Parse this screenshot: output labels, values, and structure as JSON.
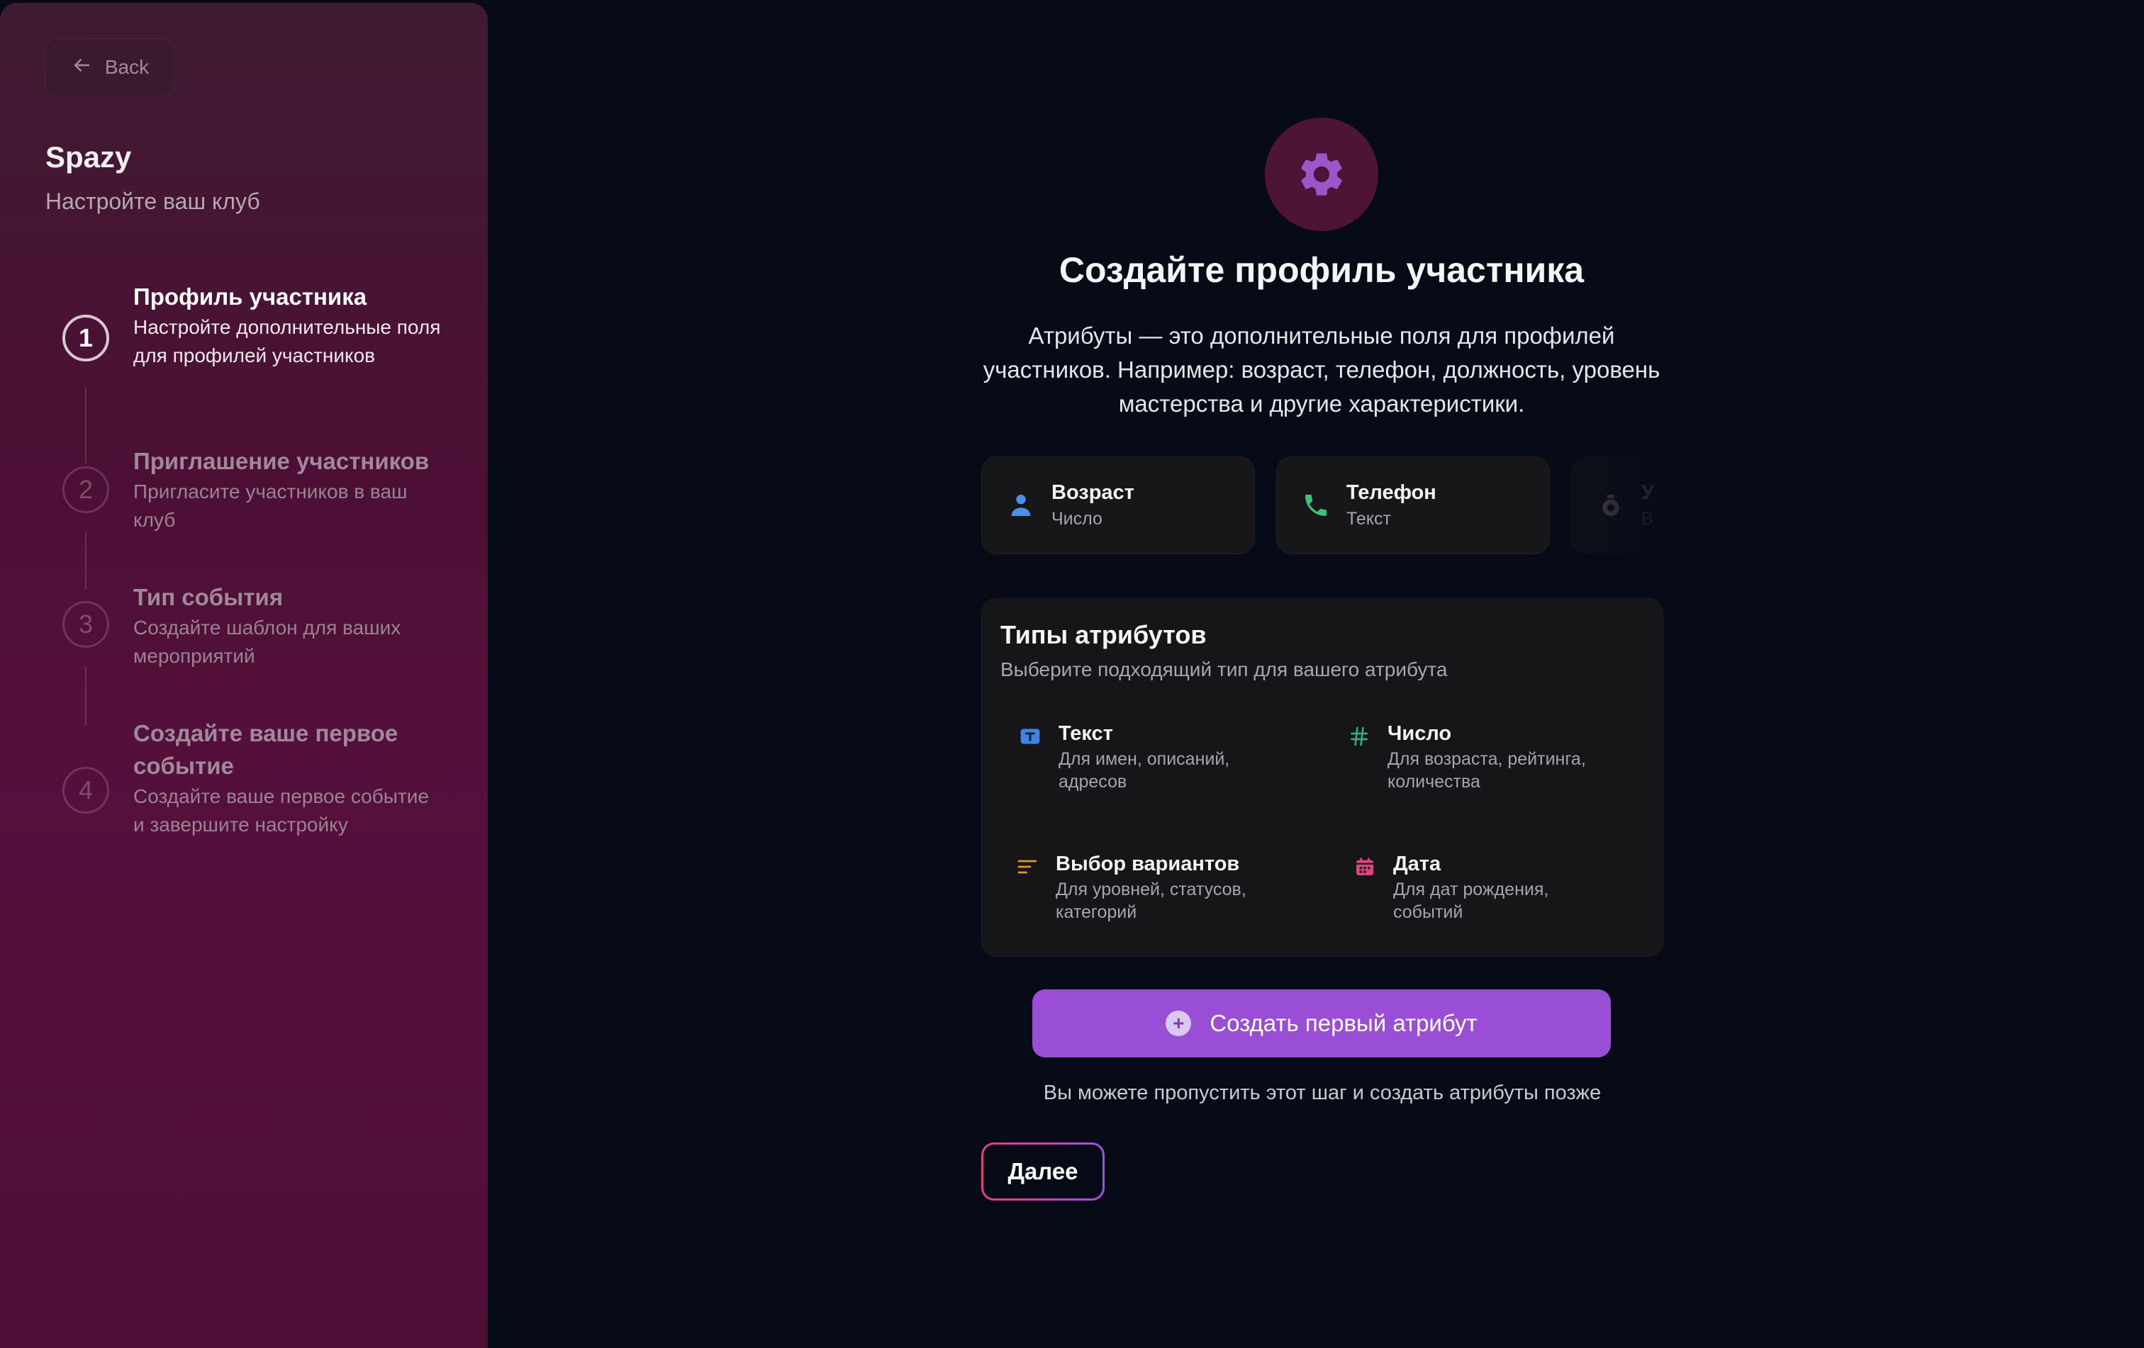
{
  "sidebar": {
    "back_label": "Back",
    "brand_title": "Spazy",
    "brand_subtitle": "Настройте ваш клуб",
    "steps": [
      {
        "number": "1",
        "title": "Профиль участника",
        "description": "Настройте дополнительные поля для профилей участников",
        "state": "active"
      },
      {
        "number": "2",
        "title": "Приглашение участников",
        "description": "Пригласите участников в ваш клуб",
        "state": "idle"
      },
      {
        "number": "3",
        "title": "Тип события",
        "description": "Создайте шаблон для ваших мероприятий",
        "state": "idle"
      },
      {
        "number": "4",
        "title": "Создайте ваше первое событие",
        "description": "Создайте ваше первое событие и завершите настройку",
        "state": "idle"
      }
    ]
  },
  "main": {
    "hero_icon": "gear-icon",
    "title": "Создайте профиль участника",
    "description": "Атрибуты — это дополнительные поля для профилей участников. Например: возраст, телефон, должность, уровень мастерства и другие характеристики.",
    "example_attributes": [
      {
        "name": "Возраст",
        "type": "Число",
        "icon": "person-icon"
      },
      {
        "name": "Телефон",
        "type": "Текст",
        "icon": "phone-icon"
      },
      {
        "name": "У",
        "type": "В",
        "icon": "badge-icon"
      }
    ],
    "types_panel": {
      "title": "Типы атрибутов",
      "subtitle": "Выберите подходящий тип для вашего атрибута",
      "types": [
        {
          "name": "Текст",
          "description": "Для имен, описаний, адресов",
          "icon": "text-icon"
        },
        {
          "name": "Число",
          "description": "Для возраста, рейтинга, количества",
          "icon": "hash-icon"
        },
        {
          "name": "Выбор вариантов",
          "description": "Для уровней, статусов, категорий",
          "icon": "list-icon"
        },
        {
          "name": "Дата",
          "description": "Для дат рождения, событий",
          "icon": "calendar-icon"
        }
      ]
    },
    "create_button_label": "Создать первый атрибут",
    "skip_note": "Вы можете пропустить этот шаг и создать атрибуты позже",
    "next_button_label": "Далее"
  },
  "colors": {
    "background": "#070b18",
    "sidebar_top": "#3f1b31",
    "sidebar_bottom": "#55103c",
    "primary_button": "#9a4ed6",
    "next_gradient_start": "#e0437e",
    "next_gradient_end": "#a24fe0"
  }
}
